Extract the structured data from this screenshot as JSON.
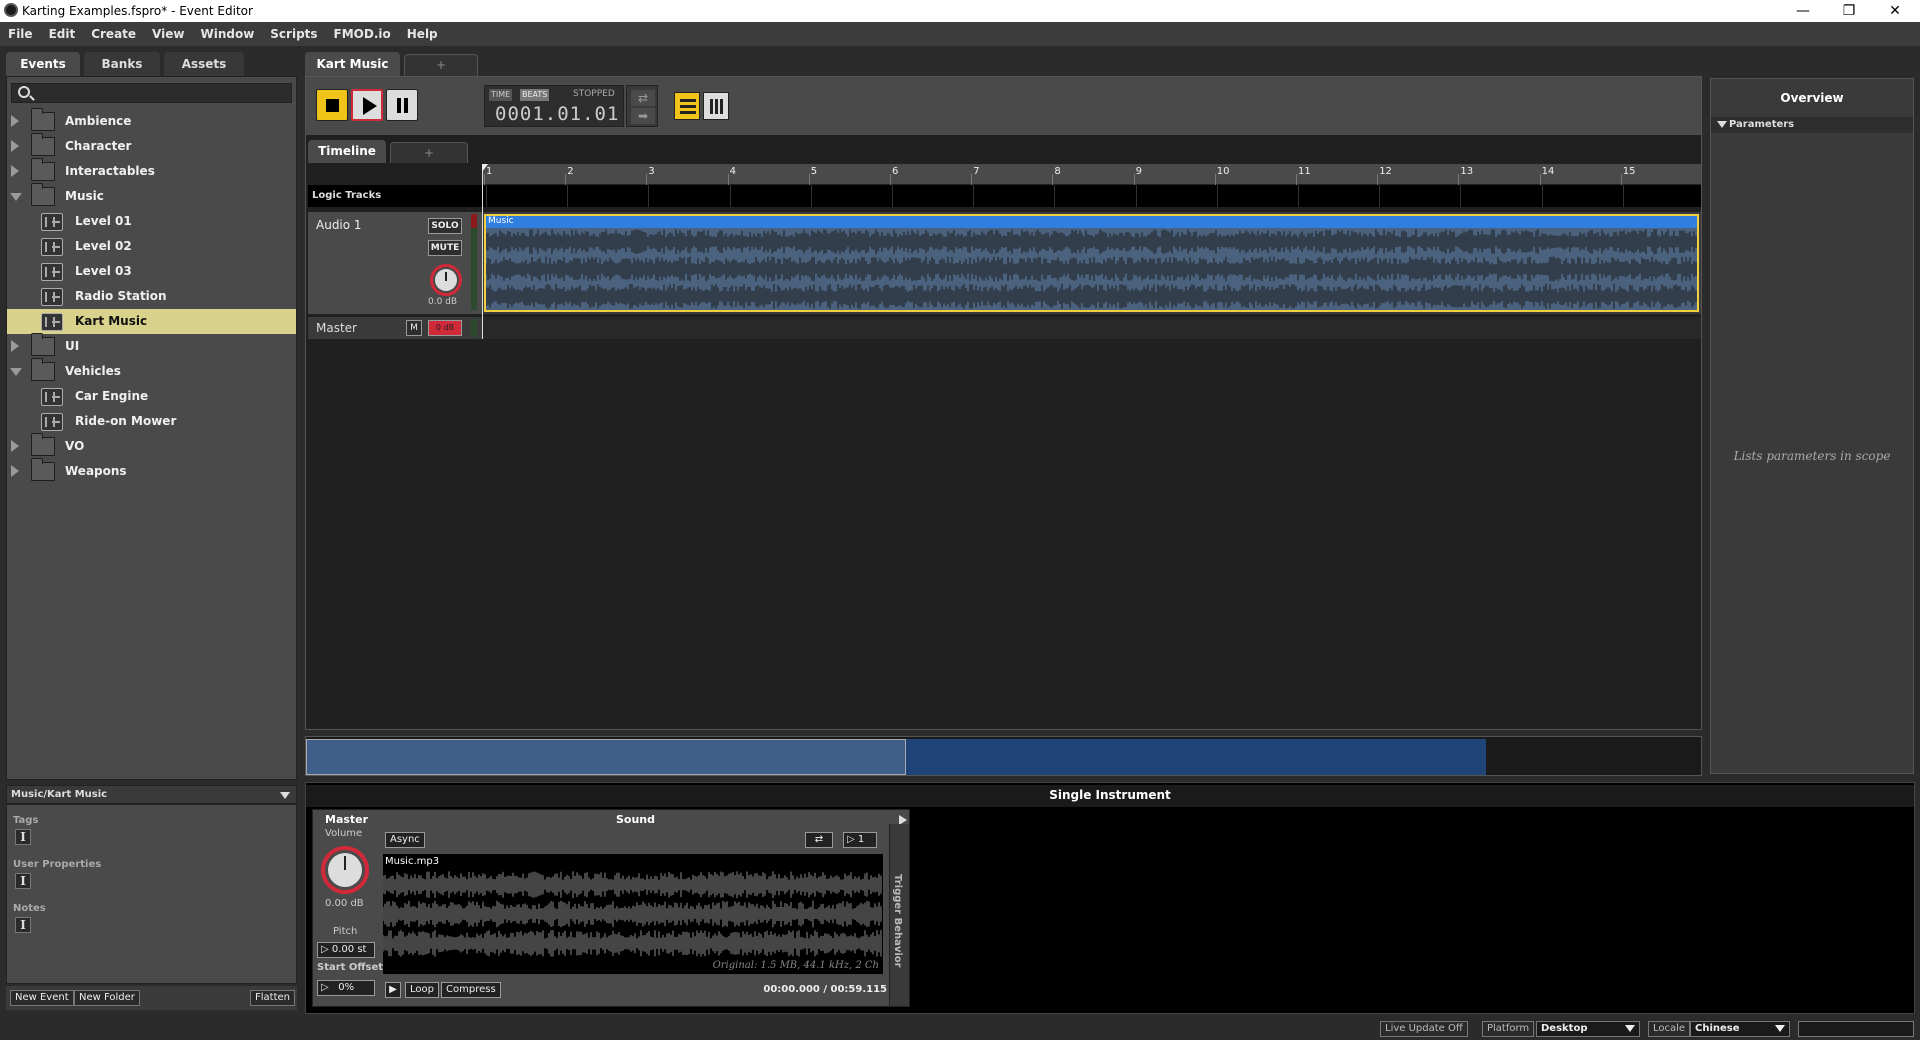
{
  "window": {
    "title": "Karting Examples.fspro* - Event Editor",
    "buttons": {
      "minimize": "—",
      "maximize": "❐",
      "close": "✕"
    }
  },
  "menu": [
    "File",
    "Edit",
    "Create",
    "View",
    "Window",
    "Scripts",
    "FMOD.io",
    "Help"
  ],
  "browser": {
    "tabs": [
      "Events",
      "Banks",
      "Assets"
    ],
    "search_placeholder": "",
    "tree": [
      {
        "label": "Ambience",
        "type": "folder",
        "state": "collapsed",
        "depth": 0
      },
      {
        "label": "Character",
        "type": "folder",
        "state": "collapsed",
        "depth": 0
      },
      {
        "label": "Interactables",
        "type": "folder",
        "state": "collapsed",
        "depth": 0
      },
      {
        "label": "Music",
        "type": "folder",
        "state": "expanded",
        "depth": 0
      },
      {
        "label": "Level 01",
        "type": "event",
        "depth": 1
      },
      {
        "label": "Level 02",
        "type": "event",
        "depth": 1
      },
      {
        "label": "Level 03",
        "type": "event",
        "depth": 1
      },
      {
        "label": "Radio Station",
        "type": "event",
        "depth": 1
      },
      {
        "label": "Kart Music",
        "type": "event",
        "depth": 1,
        "selected": true
      },
      {
        "label": "UI",
        "type": "folder",
        "state": "collapsed",
        "depth": 0
      },
      {
        "label": "Vehicles",
        "type": "folder",
        "state": "expanded",
        "depth": 0
      },
      {
        "label": "Car Engine",
        "type": "event",
        "depth": 1
      },
      {
        "label": "Ride-on Mower",
        "type": "event",
        "depth": 1
      },
      {
        "label": "VO",
        "type": "folder",
        "state": "collapsed",
        "depth": 0
      },
      {
        "label": "Weapons",
        "type": "folder",
        "state": "collapsed",
        "depth": 0
      }
    ]
  },
  "properties": {
    "path": "Music/Kart Music",
    "fields": [
      "Tags",
      "User Properties",
      "Notes"
    ],
    "footer_buttons": {
      "new_event": "New Event",
      "new_folder": "New Folder",
      "flatten": "Flatten"
    }
  },
  "event_editor": {
    "tab_label": "Kart Music",
    "add_tab": "+",
    "transport": {
      "time_tag": "TIME",
      "beats_tag": "BEATS",
      "state": "STOPPED",
      "position": "0001.01.01",
      "loop_glyph": "⇄",
      "follow_glyph": "➡"
    },
    "timeline_tab": "Timeline",
    "timeline_add": "+",
    "ruler": [
      "1",
      "2",
      "3",
      "4",
      "5",
      "6",
      "7",
      "8",
      "9",
      "10",
      "11",
      "12",
      "13",
      "14",
      "15"
    ],
    "logic_tracks_label": "Logic Tracks",
    "audio_track": {
      "name": "Audio 1",
      "solo": "SOLO",
      "mute": "MUTE",
      "volume": "0.0 dB",
      "clip_label": "Music"
    },
    "master_track": {
      "name": "Master",
      "mute": "M",
      "fader": "0 dB"
    }
  },
  "overview": {
    "title": "Overview",
    "section": "Parameters",
    "hint": "Lists parameters in scope"
  },
  "deck": {
    "title": "Single Instrument",
    "master_label": "Master",
    "sound_label": "Sound",
    "volume_label": "Volume",
    "volume_value": "0.00 dB",
    "pitch_label": "Pitch",
    "pitch_value": "0.00 st",
    "start_offset_label": "Start Offset",
    "start_offset_value": "0%",
    "async": "Async",
    "loop_count": "1",
    "file": "Music.mp3",
    "file_info": "Original: 1.5 MB, 44.1 kHz, 2 Ch",
    "loop_btn": "Loop",
    "compress_btn": "Compress",
    "time": "00:00.000 / 00:59.115",
    "trigger_behavior": "Trigger Behavior"
  },
  "statusbar": {
    "live_update": "Live Update Off",
    "platform_label": "Platform",
    "platform_value": "Desktop",
    "locale_label": "Locale",
    "locale_value": "Chinese"
  },
  "colors": {
    "accent": "#f0c419",
    "selection": "#d8d28c",
    "clip_blue": "#2f7ee0",
    "record_red": "#d0293a"
  }
}
